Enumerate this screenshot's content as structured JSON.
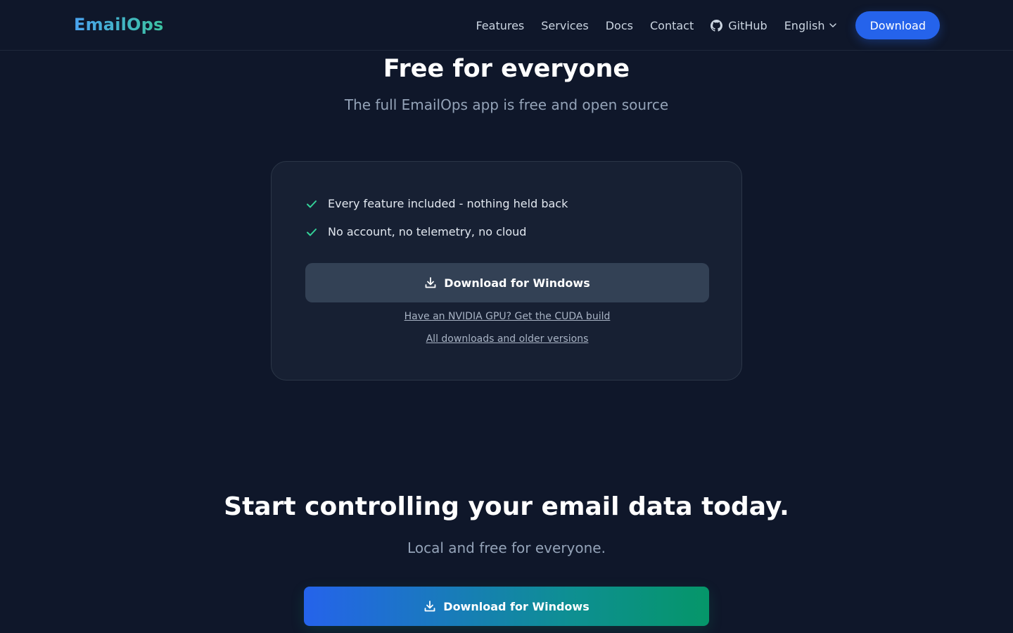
{
  "nav": {
    "logo": "EmailOps",
    "links": [
      "Features",
      "Services",
      "Docs",
      "Contact"
    ],
    "github": "GitHub",
    "language": "English",
    "download": "Download"
  },
  "hero": {
    "title": "Free for everyone",
    "subtitle": "The full EmailOps app is free and open source"
  },
  "card": {
    "features": [
      "Every feature included - nothing held back",
      "No account, no telemetry, no cloud"
    ],
    "button": "Download for Windows",
    "cuda_link": "Have an NVIDIA GPU? Get the CUDA build",
    "all_link": "All downloads and older versions"
  },
  "cta": {
    "title": "Start controlling your email data today.",
    "subtitle": "Local and free for everyone.",
    "button": "Download for Windows"
  },
  "colors": {
    "background": "#0f172a",
    "accent": "#2563eb",
    "check": "#34d399"
  }
}
